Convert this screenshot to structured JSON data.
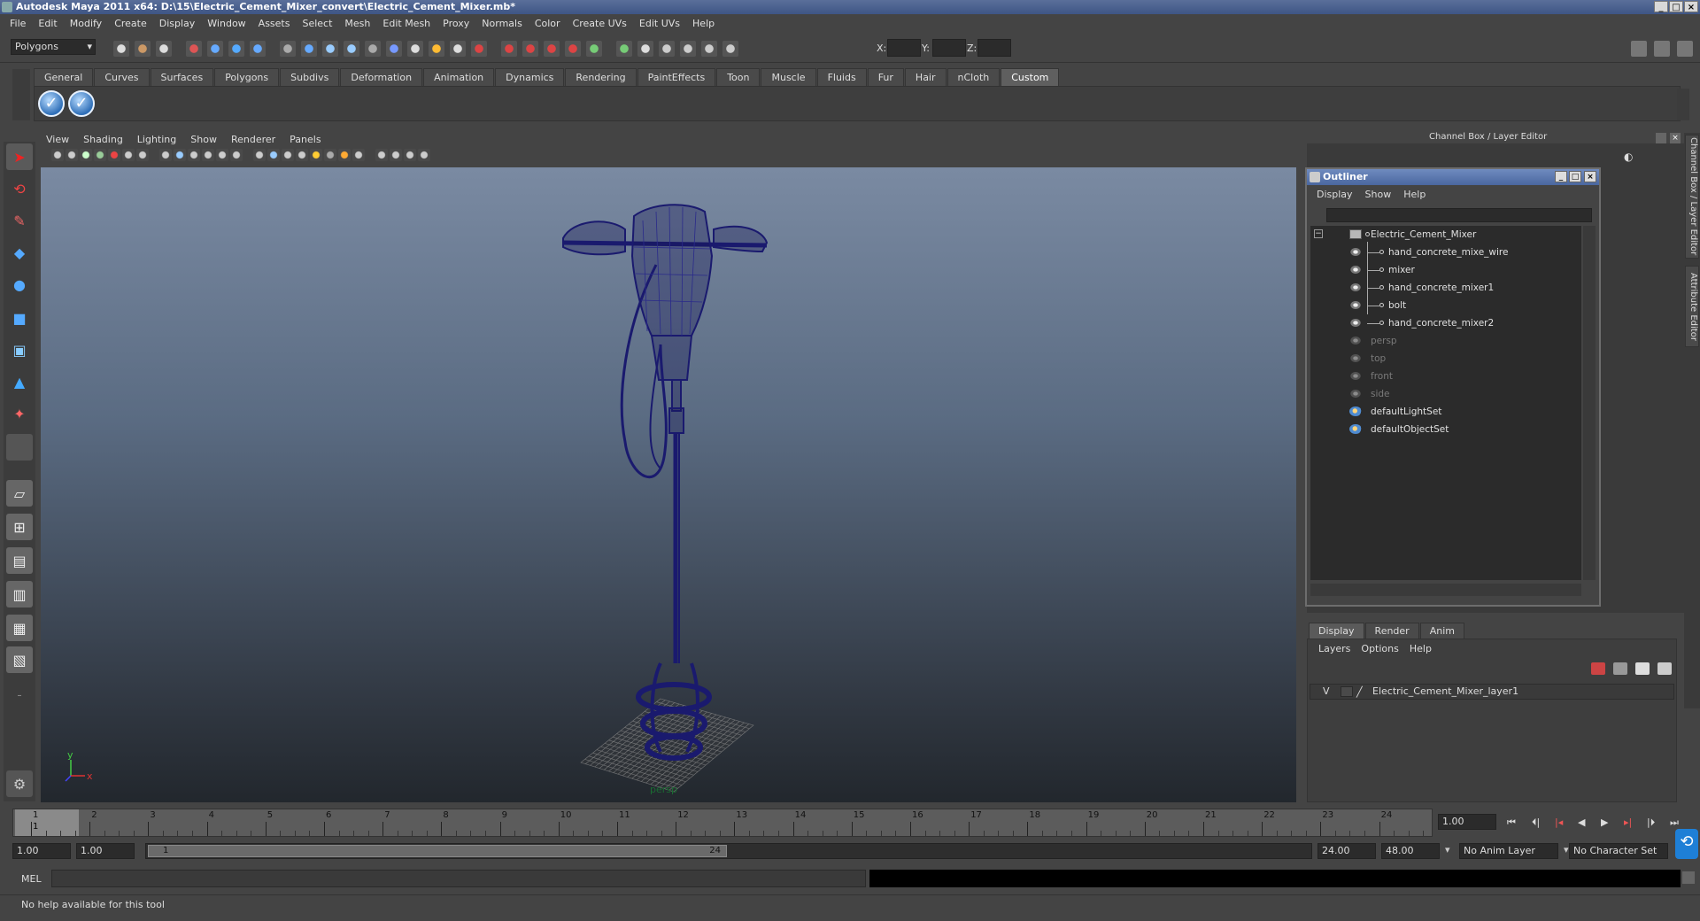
{
  "window": {
    "title": "Autodesk Maya 2011 x64: D:\\15\\Electric_Cement_Mixer_convert\\Electric_Cement_Mixer.mb*"
  },
  "menubar": [
    "File",
    "Edit",
    "Modify",
    "Create",
    "Display",
    "Window",
    "Assets",
    "Select",
    "Mesh",
    "Edit Mesh",
    "Proxy",
    "Normals",
    "Color",
    "Create UVs",
    "Edit UVs",
    "Help"
  ],
  "statusline": {
    "menuset": "Polygons",
    "x_label": "X:",
    "y_label": "Y:",
    "z_label": "Z:"
  },
  "shelf": {
    "tabs": [
      "General",
      "Curves",
      "Surfaces",
      "Polygons",
      "Subdivs",
      "Deformation",
      "Animation",
      "Dynamics",
      "Rendering",
      "PaintEffects",
      "Toon",
      "Muscle",
      "Fluids",
      "Fur",
      "Hair",
      "nCloth",
      "Custom"
    ],
    "active_tab": "Custom"
  },
  "panel": {
    "menu": [
      "View",
      "Shading",
      "Lighting",
      "Show",
      "Renderer",
      "Panels"
    ],
    "camera_label": "persp",
    "axis_y": "y",
    "axis_x": "x"
  },
  "channelbox": {
    "header": "Channel Box / Layer Editor",
    "side_tab_1": "Channel Box / Layer Editor",
    "side_tab_2": "Attribute Editor"
  },
  "outliner": {
    "title": "Outliner",
    "menu": [
      "Display",
      "Show",
      "Help"
    ],
    "items": [
      {
        "label": "Electric_Cement_Mixer",
        "level": 0,
        "type": "group",
        "dim": false
      },
      {
        "label": "hand_concrete_mixe_wire",
        "level": 1,
        "type": "mesh",
        "dim": false
      },
      {
        "label": "mixer",
        "level": 1,
        "type": "mesh",
        "dim": false
      },
      {
        "label": "hand_concrete_mixer1",
        "level": 1,
        "type": "mesh",
        "dim": false
      },
      {
        "label": "bolt",
        "level": 1,
        "type": "mesh",
        "dim": false
      },
      {
        "label": "hand_concrete_mixer2",
        "level": 1,
        "type": "mesh",
        "dim": false
      },
      {
        "label": "persp",
        "level": 0,
        "type": "camera",
        "dim": true
      },
      {
        "label": "top",
        "level": 0,
        "type": "camera",
        "dim": true
      },
      {
        "label": "front",
        "level": 0,
        "type": "camera",
        "dim": true
      },
      {
        "label": "side",
        "level": 0,
        "type": "camera",
        "dim": true
      },
      {
        "label": "defaultLightSet",
        "level": 0,
        "type": "set",
        "dim": false
      },
      {
        "label": "defaultObjectSet",
        "level": 0,
        "type": "set",
        "dim": false
      }
    ]
  },
  "layereditor": {
    "tabs": [
      "Display",
      "Render",
      "Anim"
    ],
    "menu": [
      "Layers",
      "Options",
      "Help"
    ],
    "layer": {
      "visible": "V",
      "name": "Electric_Cement_Mixer_layer1"
    }
  },
  "timeline": {
    "ticks": [
      "1",
      "2",
      "3",
      "4",
      "5",
      "6",
      "7",
      "8",
      "9",
      "10",
      "11",
      "12",
      "13",
      "14",
      "15",
      "16",
      "17",
      "18",
      "19",
      "20",
      "21",
      "22",
      "23",
      "24"
    ],
    "current_frame": "1",
    "current_time_field": "1.00"
  },
  "range": {
    "start": "1.00",
    "playback_start": "1.00",
    "slider_start": "1",
    "slider_end": "24",
    "playback_end": "24.00",
    "end": "48.00",
    "anim_layer": "No Anim Layer",
    "character_set": "No Character Set"
  },
  "commandline": {
    "label": "MEL"
  },
  "helpline": {
    "text": "No help available for this tool"
  },
  "colors": {
    "mesh_wire": "#1a1a6e",
    "accent_blue": "#4a67a0"
  }
}
